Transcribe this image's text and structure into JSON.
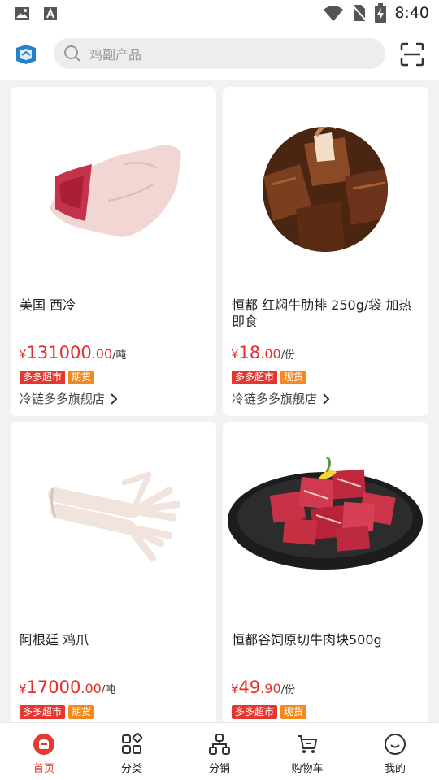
{
  "status_bar": {
    "time": "8:40"
  },
  "header": {
    "search_placeholder": "鸡副产品"
  },
  "products": [
    {
      "title": "美国 西冷",
      "price_currency": "¥",
      "price_int": "131000",
      "price_dec": ".00",
      "unit": "/吨",
      "tags": [
        "多多超市",
        "期货"
      ],
      "shop": "冷链多多旗舰店"
    },
    {
      "title": "恒都 红焖牛肋排 250g/袋 加热即食",
      "price_currency": "¥",
      "price_int": "18",
      "price_dec": ".00",
      "unit": "/份",
      "tags": [
        "多多超市",
        "现货"
      ],
      "shop": "冷链多多旗舰店"
    },
    {
      "title": "阿根廷 鸡爪",
      "price_currency": "¥",
      "price_int": "17000",
      "price_dec": ".00",
      "unit": "/吨",
      "tags": [
        "多多超市",
        "期货"
      ],
      "shop": ""
    },
    {
      "title": "恒都谷饲原切牛肉块500g",
      "price_currency": "¥",
      "price_int": "49",
      "price_dec": ".90",
      "unit": "/份",
      "tags": [
        "多多超市",
        "现货"
      ],
      "shop": ""
    }
  ],
  "bottom_nav": [
    {
      "label": "首页",
      "icon": "home-icon",
      "active": true
    },
    {
      "label": "分类",
      "icon": "category-icon",
      "active": false
    },
    {
      "label": "分销",
      "icon": "distribution-icon",
      "active": false
    },
    {
      "label": "购物车",
      "icon": "cart-icon",
      "active": false
    },
    {
      "label": "我的",
      "icon": "profile-icon",
      "active": false
    }
  ],
  "colors": {
    "accent": "#e53a2f",
    "tag_red": "#e5372f",
    "tag_orange": "#f3891e",
    "price": "#e42d2d"
  }
}
